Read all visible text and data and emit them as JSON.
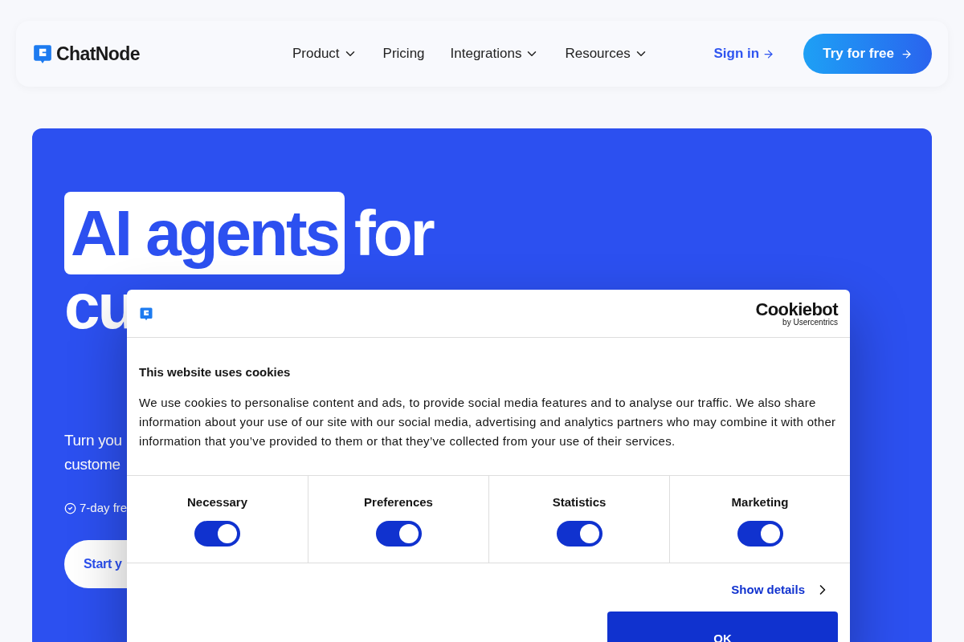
{
  "nav": {
    "brand": "ChatNode",
    "items": [
      {
        "label": "Product",
        "dropdown": true
      },
      {
        "label": "Pricing",
        "dropdown": false
      },
      {
        "label": "Integrations",
        "dropdown": true
      },
      {
        "label": "Resources",
        "dropdown": true
      }
    ],
    "sign_in": "Sign in",
    "cta": "Try for free"
  },
  "hero": {
    "highlight": "AI agents",
    "title_rest": "for",
    "title_line2": "cu",
    "subtitle_lines": [
      "Turn you",
      "custome"
    ],
    "note": "7-day fre",
    "button": "Start y"
  },
  "cookie_dialog": {
    "brand": "Cookiebot",
    "brand_sub": "by Usercentrics",
    "heading": "This website uses cookies",
    "body": "We use cookies to personalise content and ads, to provide social media features and to analyse our traffic. We also share information about your use of our site with our social media, advertising and analytics partners who may combine it with other information that you’ve provided to them or that they’ve collected from your use of their services.",
    "categories": [
      {
        "label": "Necessary",
        "on": true
      },
      {
        "label": "Preferences",
        "on": true
      },
      {
        "label": "Statistics",
        "on": true
      },
      {
        "label": "Marketing",
        "on": true
      }
    ],
    "show_details": "Show details",
    "ok": "OK"
  }
}
